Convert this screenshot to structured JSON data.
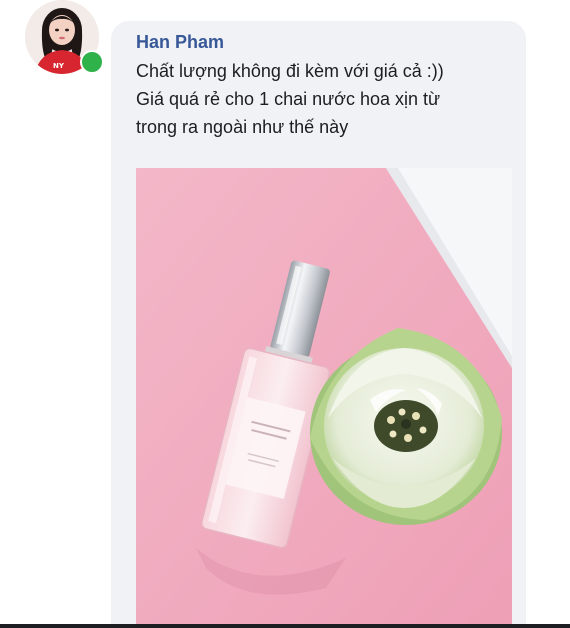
{
  "post": {
    "author": "Han Pham",
    "lines": [
      "Chất lượng không đi kèm với giá cả :))",
      "Giá quá rẻ cho 1 chai nước hoa xịn từ",
      "trong ra ngoài như thế này"
    ]
  },
  "avatar": {
    "online": true
  },
  "colors": {
    "author_name": "#385898",
    "bubble": "#f0f2f5",
    "online_dot": "#2fb24a",
    "photo_pink": "#f2b8c8"
  },
  "icons": {
    "status": "online-status-dot"
  }
}
